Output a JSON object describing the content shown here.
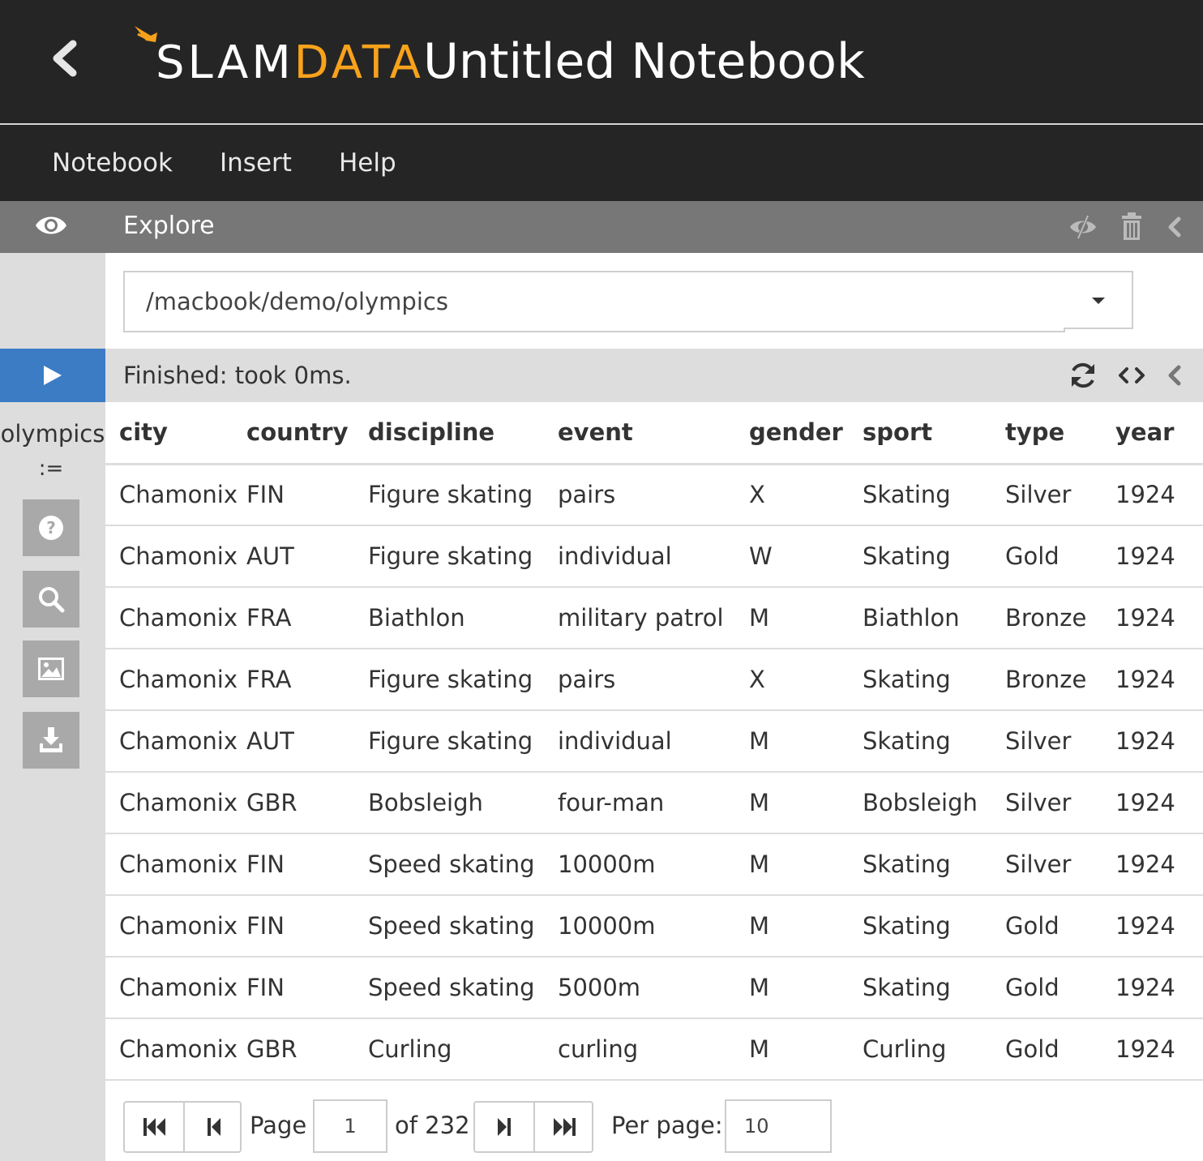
{
  "header": {
    "logo_part1": "SLAM",
    "logo_part2": "DATA",
    "notebook_title": "Untitled Notebook",
    "brand_color": "#f8a21c"
  },
  "menu": {
    "items": [
      "Notebook",
      "Insert",
      "Help"
    ]
  },
  "cell": {
    "title": "Explore",
    "path_value": "/macbook/demo/olympics",
    "status": "Finished: took 0ms.",
    "variable_name": "olympics",
    "assign_symbol": ":=",
    "side_tools": [
      "help-icon",
      "search-icon",
      "image-icon",
      "download-icon"
    ],
    "header_icons": [
      "hide-code-icon",
      "trash-icon",
      "collapse-icon"
    ],
    "status_icons": [
      "refresh-icon",
      "code-icon",
      "collapse-icon"
    ]
  },
  "table": {
    "columns": [
      "city",
      "country",
      "discipline",
      "event",
      "gender",
      "sport",
      "type",
      "year"
    ],
    "rows": [
      [
        "Chamonix",
        "FIN",
        "Figure skating",
        "pairs",
        "X",
        "Skating",
        "Silver",
        "1924"
      ],
      [
        "Chamonix",
        "AUT",
        "Figure skating",
        "individual",
        "W",
        "Skating",
        "Gold",
        "1924"
      ],
      [
        "Chamonix",
        "FRA",
        "Biathlon",
        "military patrol",
        "M",
        "Biathlon",
        "Bronze",
        "1924"
      ],
      [
        "Chamonix",
        "FRA",
        "Figure skating",
        "pairs",
        "X",
        "Skating",
        "Bronze",
        "1924"
      ],
      [
        "Chamonix",
        "AUT",
        "Figure skating",
        "individual",
        "M",
        "Skating",
        "Silver",
        "1924"
      ],
      [
        "Chamonix",
        "GBR",
        "Bobsleigh",
        "four-man",
        "M",
        "Bobsleigh",
        "Silver",
        "1924"
      ],
      [
        "Chamonix",
        "FIN",
        "Speed skating",
        "10000m",
        "M",
        "Skating",
        "Silver",
        "1924"
      ],
      [
        "Chamonix",
        "FIN",
        "Speed skating",
        "10000m",
        "M",
        "Skating",
        "Gold",
        "1924"
      ],
      [
        "Chamonix",
        "FIN",
        "Speed skating",
        "5000m",
        "M",
        "Skating",
        "Gold",
        "1924"
      ],
      [
        "Chamonix",
        "GBR",
        "Curling",
        "curling",
        "M",
        "Curling",
        "Gold",
        "1924"
      ]
    ]
  },
  "pagination": {
    "page_label": "Page",
    "current_page": "1",
    "of_label": "of 232",
    "per_page_label": "Per page:",
    "per_page": "10"
  }
}
